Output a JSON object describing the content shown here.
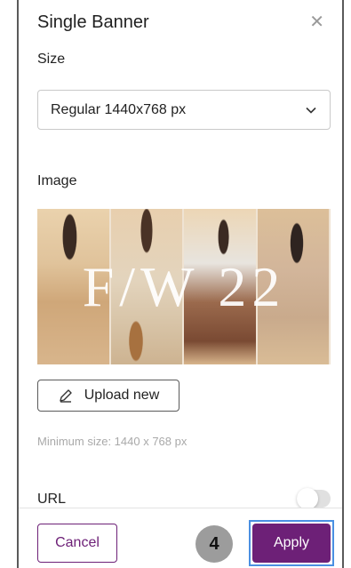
{
  "modal": {
    "title": "Single Banner",
    "close_icon": "close-icon"
  },
  "size": {
    "label": "Size",
    "selected": "Regular 1440x768 px"
  },
  "image": {
    "label": "Image",
    "overlay_text": "F/W 22"
  },
  "upload": {
    "label": "Upload new",
    "hint": "Minimum size: 1440 x 768 px"
  },
  "url": {
    "label": "URL",
    "toggle_on": false
  },
  "footer": {
    "cancel_label": "Cancel",
    "apply_label": "Apply",
    "step_number": "4"
  },
  "colors": {
    "brand": "#6d2077",
    "highlight": "#4a90e2",
    "badge": "#9c9c9c"
  }
}
